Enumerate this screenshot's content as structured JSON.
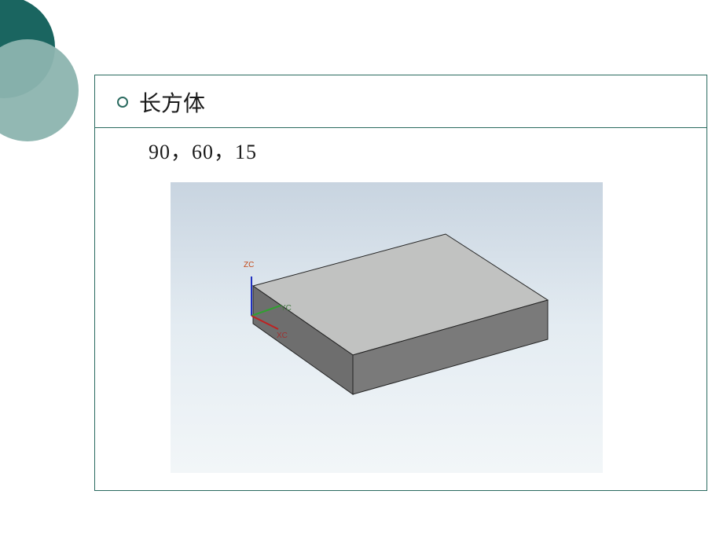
{
  "slide": {
    "bullet_title": "长方体",
    "dimensions_text": "90，60，15"
  },
  "viewport": {
    "axis_labels": {
      "zc": "ZC",
      "yc": "YC",
      "xc": "XC"
    },
    "cuboid_dimensions": {
      "length": 90,
      "width": 60,
      "height": 15
    },
    "face_colors": {
      "top": "#c1c2c1",
      "front": "#6e6e6e",
      "side": "#7a7a7a"
    },
    "axis_colors": {
      "x": "#c02020",
      "y": "#30a030",
      "z": "#2030c0"
    }
  }
}
